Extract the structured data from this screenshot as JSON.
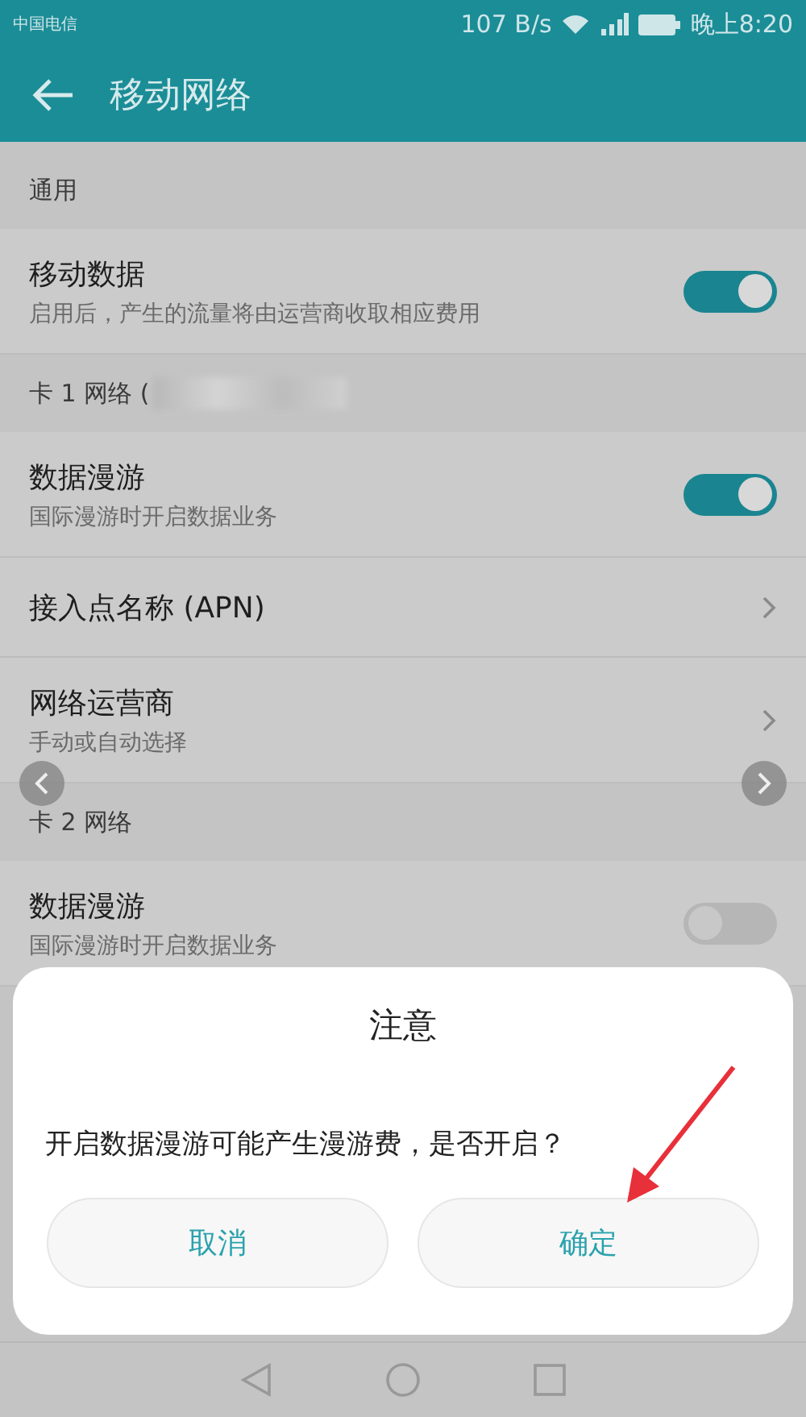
{
  "status_bar": {
    "carrier": "中国电信",
    "speed": "107 B/s",
    "time": "晚上8:20"
  },
  "header": {
    "title": "移动网络"
  },
  "sections": [
    {
      "title": "通用",
      "items": [
        {
          "kind": "switch",
          "title": "移动数据",
          "subtitle": "启用后，产生的流量将由运营商收取相应费用",
          "on": true
        }
      ]
    },
    {
      "title": "卡 1 网络 (",
      "redacted": true,
      "items": [
        {
          "kind": "switch",
          "title": "数据漫游",
          "subtitle": "国际漫游时开启数据业务",
          "on": true
        },
        {
          "kind": "link",
          "title": "接入点名称 (APN)"
        },
        {
          "kind": "link",
          "title": "网络运营商",
          "subtitle": "手动或自动选择"
        }
      ]
    },
    {
      "title": "卡 2 网络",
      "items": [
        {
          "kind": "switch",
          "title": "数据漫游",
          "subtitle": "国际漫游时开启数据业务",
          "on": false
        }
      ]
    }
  ],
  "dialog": {
    "title": "注意",
    "message": "开启数据漫游可能产生漫游费，是否开启？",
    "buttons": [
      "取消",
      "确定"
    ]
  }
}
